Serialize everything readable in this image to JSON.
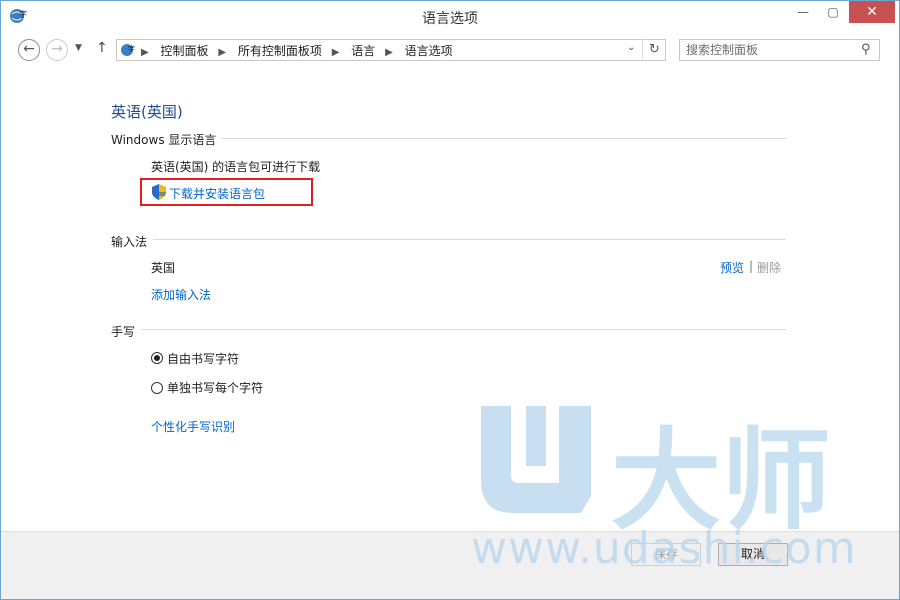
{
  "window": {
    "title": "语言选项",
    "controls": {
      "minimize": "—",
      "maximize": "▢",
      "close": "✕"
    }
  },
  "navbar": {
    "breadcrumbs": [
      "控制面板",
      "所有控制面板项",
      "语言",
      "语言选项"
    ],
    "search_placeholder": "搜索控制面板"
  },
  "content": {
    "language_title": "英语(英国)",
    "display_language": {
      "heading": "Windows 显示语言",
      "status": "英语(英国) 的语言包可进行下载",
      "download_link": "下载并安装语言包"
    },
    "input_method": {
      "heading": "输入法",
      "item": "英国",
      "preview_link": "预览",
      "separator": "|",
      "delete_link": "删除",
      "add_link": "添加输入法"
    },
    "handwriting": {
      "heading": "手写",
      "options": [
        {
          "label": "自由书写字符",
          "selected": true
        },
        {
          "label": "单独书写每个字符",
          "selected": false
        }
      ],
      "personalize_link": "个性化手写识别"
    }
  },
  "footer": {
    "save_label": "保存",
    "cancel_label": "取消"
  },
  "watermark": {
    "chinese": "大师",
    "url": "www.udashi.com"
  },
  "colors": {
    "link": "#0066cc",
    "title": "#1e4e8c",
    "highlight_border": "#e02020",
    "close_button": "#c75050",
    "watermark": "#b9d7ee"
  }
}
